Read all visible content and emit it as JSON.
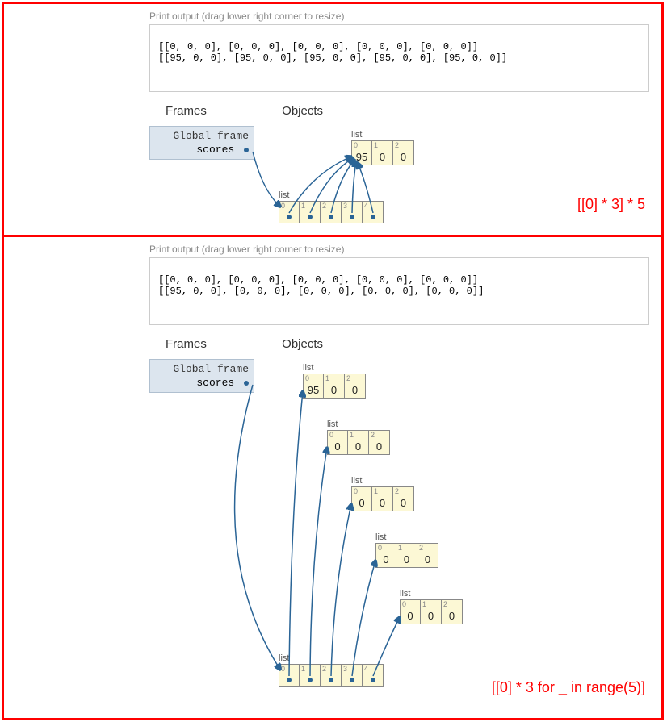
{
  "panel1": {
    "print_label": "Print output (drag lower right corner to resize)",
    "output_line1": "[[0, 0, 0], [0, 0, 0], [0, 0, 0], [0, 0, 0], [0, 0, 0]]",
    "output_line2": "[[95, 0, 0], [95, 0, 0], [95, 0, 0], [95, 0, 0], [95, 0, 0]]",
    "h_frames": "Frames",
    "h_objects": "Objects",
    "frame_title": "Global frame",
    "frame_var": "scores",
    "outer_list_label": "list",
    "outer_idx": [
      "0",
      "1",
      "2",
      "3",
      "4"
    ],
    "inner_list_label": "list",
    "inner_idx": [
      "0",
      "1",
      "2"
    ],
    "inner_vals": [
      "95",
      "0",
      "0"
    ],
    "caption": "[[0] * 3] * 5"
  },
  "panel2": {
    "print_label": "Print output (drag lower right corner to resize)",
    "output_line1": "[[0, 0, 0], [0, 0, 0], [0, 0, 0], [0, 0, 0], [0, 0, 0]]",
    "output_line2": "[[95, 0, 0], [0, 0, 0], [0, 0, 0], [0, 0, 0], [0, 0, 0]]",
    "h_frames": "Frames",
    "h_objects": "Objects",
    "frame_title": "Global frame",
    "frame_var": "scores",
    "outer_list_label": "list",
    "outer_idx": [
      "0",
      "1",
      "2",
      "3",
      "4"
    ],
    "inner_list_label": "list",
    "inner_idx": [
      "0",
      "1",
      "2"
    ],
    "list0_vals": [
      "95",
      "0",
      "0"
    ],
    "list1_vals": [
      "0",
      "0",
      "0"
    ],
    "list2_vals": [
      "0",
      "0",
      "0"
    ],
    "list3_vals": [
      "0",
      "0",
      "0"
    ],
    "list4_vals": [
      "0",
      "0",
      "0"
    ],
    "caption": "[[0] * 3 for _ in range(5)]"
  }
}
